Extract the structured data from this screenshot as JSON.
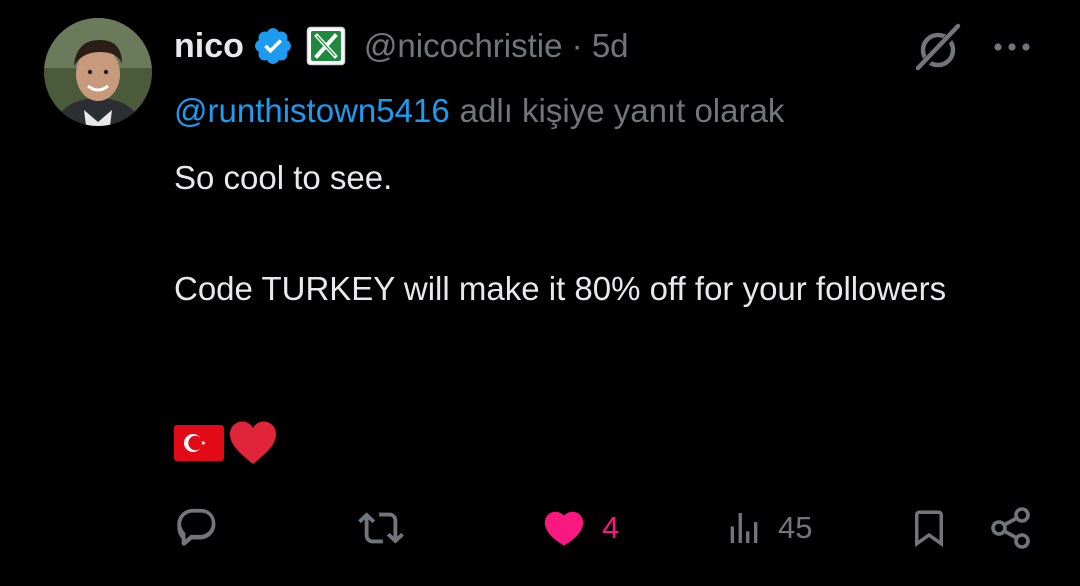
{
  "tweet": {
    "author_name": "nico",
    "author_handle": "@nicochristie",
    "separator": "·",
    "time_ago": "5d",
    "reply_to_mention": "@runthistown5416",
    "reply_to_suffix": "adlı kişiye yanıt olarak",
    "body_line1": "So cool to see.",
    "body_line2": "Code TURKEY will make it 80% off for your followers",
    "emojis": [
      "turkey-flag",
      "red-heart"
    ]
  },
  "actions": {
    "reply_count": "",
    "retweet_count": "",
    "like_count": "4",
    "view_count": "45",
    "liked": true
  },
  "colors": {
    "background": "#000000",
    "text": "#e7e9ea",
    "secondary": "#71767b",
    "link": "#1d9bf0",
    "like": "#f91880",
    "verified": "#1d9bf0"
  },
  "icons": {
    "verified": "verified-badge-icon",
    "affiliate": "affiliate-x-badge-icon",
    "grok": "grok-icon",
    "more": "more-dots-icon",
    "reply": "reply-bubble-icon",
    "retweet": "retweet-icon",
    "like": "heart-icon",
    "views": "views-bar-icon",
    "bookmark": "bookmark-icon",
    "share": "share-icon"
  }
}
